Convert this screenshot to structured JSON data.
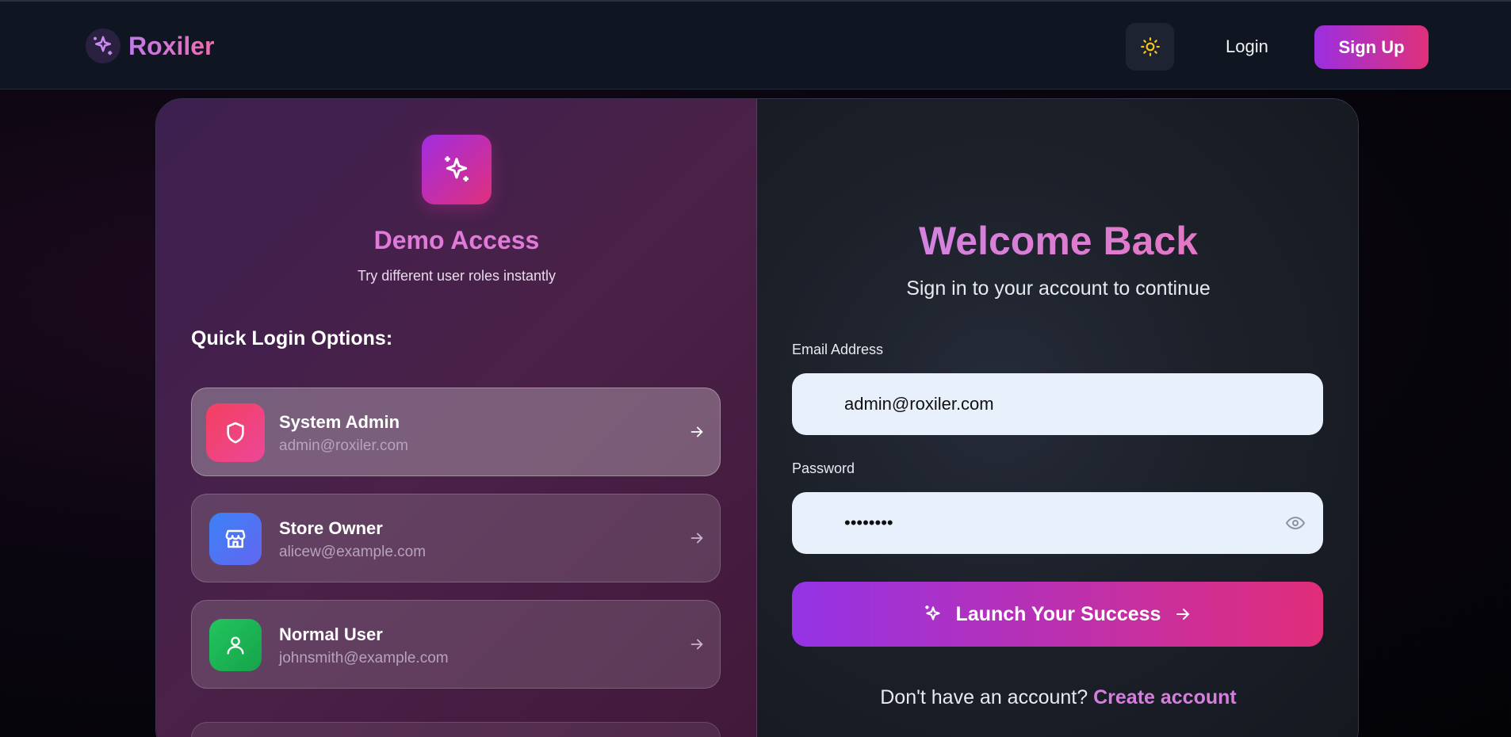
{
  "nav": {
    "brand": "Roxiler",
    "login_label": "Login",
    "signup_label": "Sign Up"
  },
  "demo": {
    "title": "Demo Access",
    "subtitle": "Try different user roles instantly",
    "quick_title": "Quick Login Options:",
    "roles": [
      {
        "name": "System Admin",
        "email": "admin@roxiler.com",
        "icon": "shield-icon",
        "color": "#ef3b5f"
      },
      {
        "name": "Store Owner",
        "email": "alicew@example.com",
        "icon": "store-icon",
        "color": "#4c6ef5"
      },
      {
        "name": "Normal User",
        "email": "johnsmith@example.com",
        "icon": "user-icon",
        "color": "#22c55e"
      }
    ]
  },
  "form": {
    "title": "Welcome Back",
    "subtitle": "Sign in to your account to continue",
    "email_label": "Email Address",
    "email_value": "admin@roxiler.com",
    "password_label": "Password",
    "password_value": "password",
    "submit_label": "Launch Your Success",
    "signup_prompt": "Don't have an account?",
    "signup_link": "Create account"
  },
  "colors": {
    "accent_start": "#9433e6",
    "accent_end": "#e12d7a"
  }
}
